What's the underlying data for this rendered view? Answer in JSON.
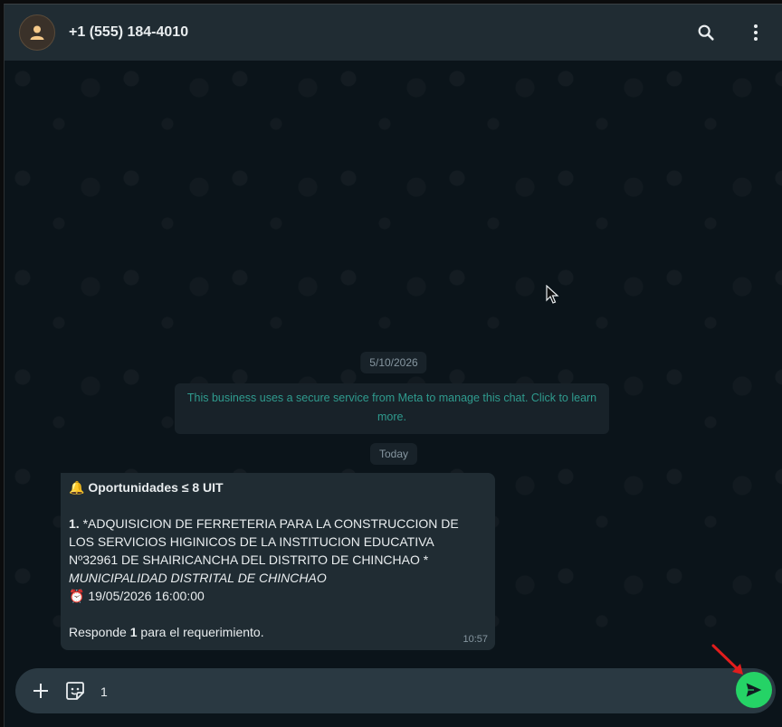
{
  "header": {
    "contact_name": "+1 (555) 184-4010",
    "avatar_icon": "user-icon",
    "search_icon": "search-icon",
    "menu_icon": "more-vertical-icon"
  },
  "chat": {
    "date_older": "5/10/2026",
    "notice": "This business uses a secure service from Meta to manage this chat. Click to learn more.",
    "date_today": "Today",
    "message": {
      "emoji_bell": "🔔",
      "heading": "Oportunidades ≤ 8 UIT",
      "item_number": "1.",
      "item_line1": "*ADQUISICION DE FERRETERIA PARA LA CONSTRUCCION DE",
      "item_line2": "LOS SERVICIOS HIGINICOS DE LA INSTITUCION EDUCATIVA",
      "item_line3": "Nº32961 DE SHAIRICANCHA DEL DISTRITO DE CHINCHAO *",
      "entity": "MUNICIPALIDAD DISTRITAL DE CHINCHAO",
      "emoji_clock": "⏰",
      "deadline": "19/05/2026 16:00:00",
      "reply_prefix": "Responde",
      "reply_number": "1",
      "reply_suffix": "para el requerimiento.",
      "time": "10:57"
    }
  },
  "composer": {
    "input_value": "1",
    "attach_icon": "plus-icon",
    "sticker_icon": "sticker-icon",
    "send_icon": "send-icon"
  },
  "colors": {
    "header_bg": "#202c33",
    "chat_bg": "#0b141a",
    "bubble_bg": "#202c33",
    "notice_text": "#2f9b8e",
    "send_bg": "#25d366",
    "annotation_arrow": "#e11d1d"
  }
}
